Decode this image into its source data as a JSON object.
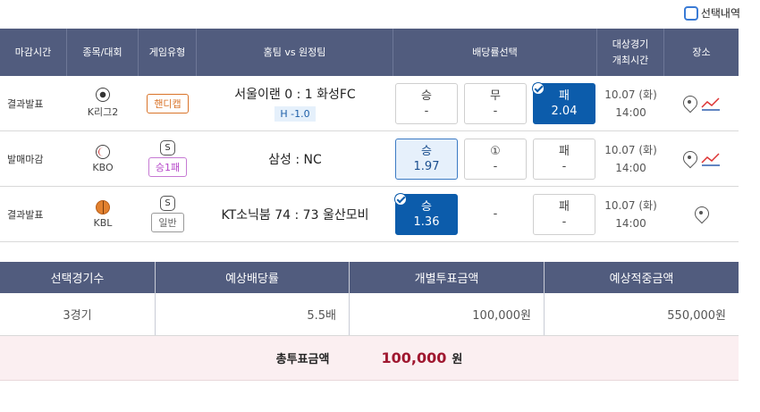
{
  "selection_history": {
    "label": "선택내역"
  },
  "headers": {
    "time": "마감시간",
    "sport": "종목/대회",
    "game_type": "게임유형",
    "match": "홈팀 vs 원정팀",
    "odds": "배당률선택",
    "date_line1": "대상경기",
    "date_line2": "개최시간",
    "venue": "장소"
  },
  "rows": [
    {
      "status": "결과발표",
      "sport_icon": "soccer-ball-icon",
      "league": "K리그2",
      "s_mark": "",
      "game_type": "핸디캡",
      "match": "서울이랜 0 : 1 화성FC",
      "handicap": "H -1.0",
      "odds": [
        {
          "label": "승",
          "value": "-"
        },
        {
          "label": "무",
          "value": "-"
        },
        {
          "label": "패",
          "value": "2.04"
        }
      ],
      "date": "10.07 (화)",
      "time": "14:00"
    },
    {
      "status": "발매마감",
      "sport_icon": "baseball-icon",
      "league": "KBO",
      "s_mark": "S",
      "game_type": "승1패",
      "match": "삼성 : NC",
      "odds": [
        {
          "label": "승",
          "value": "1.97"
        },
        {
          "label": "①",
          "value": "-"
        },
        {
          "label": "패",
          "value": "-"
        }
      ],
      "date": "10.07 (화)",
      "time": "14:00"
    },
    {
      "status": "결과발표",
      "sport_icon": "basketball-icon",
      "league": "KBL",
      "s_mark": "S",
      "game_type": "일반",
      "match": "KT소닉붐 74 : 73 울산모비",
      "odds": [
        {
          "label": "승",
          "value": "1.36"
        },
        {
          "label": "",
          "value": "-"
        },
        {
          "label": "패",
          "value": "-"
        }
      ],
      "date": "10.07 (화)",
      "time": "14:00"
    }
  ],
  "summary": {
    "headers": [
      "선택경기수",
      "예상배당률",
      "개별투표금액",
      "예상적중금액"
    ],
    "values": [
      "3경기",
      "5.5배",
      "100,000원",
      "550,000원"
    ],
    "total_label": "총투표금액",
    "total_amount": "100,000",
    "total_unit": "원"
  },
  "colors": {
    "header_bg": "#515c7e",
    "selected_blue": "#0c5cab",
    "total_red": "#a01830",
    "total_bg": "#fbeff1"
  }
}
